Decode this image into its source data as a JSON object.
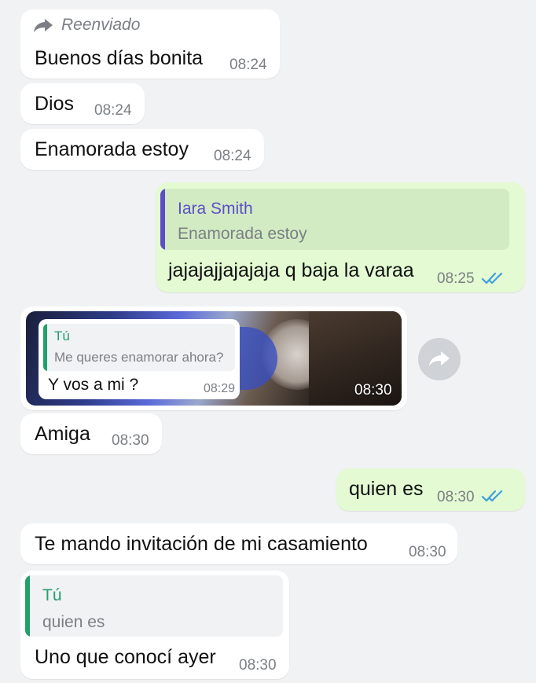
{
  "messages": {
    "m1": {
      "forward_label": "Reenviado",
      "text": "Buenos días bonita",
      "time": "08:24"
    },
    "m2": {
      "text": "Dios",
      "time": "08:24"
    },
    "m3": {
      "text": "Enamorada estoy",
      "time": "08:24"
    },
    "m4": {
      "quote_name": "Iara Smith",
      "quote_text": "Enamorada estoy",
      "text": "jajajajjajajaja q baja la varaa",
      "time": "08:25"
    },
    "m5": {
      "quote_name": "Tú",
      "quote_text": "Me queres enamorar ahora?",
      "text": "Y vos a mi ?",
      "inner_time": "08:29",
      "time": "08:30"
    },
    "m6": {
      "text": "Amiga",
      "time": "08:30"
    },
    "m7": {
      "text": "quien es",
      "time": "08:30"
    },
    "m8": {
      "text": "Te mando invitación de mi casamiento",
      "time": "08:30"
    },
    "m9": {
      "quote_name": "Tú",
      "quote_text": "quien es",
      "text": "Uno que conocí ayer",
      "time": "08:30"
    }
  },
  "colors": {
    "incoming_bubble": "#ffffff",
    "outgoing_bubble": "#e3fad2",
    "read_ticks": "#3f9fe0",
    "quote_purple": "#5b4fc8",
    "quote_green": "#22a06b"
  },
  "icons": {
    "forwarded": "forward-arrow-icon",
    "share": "share-arrow-icon",
    "read_status": "double-check-icon"
  }
}
